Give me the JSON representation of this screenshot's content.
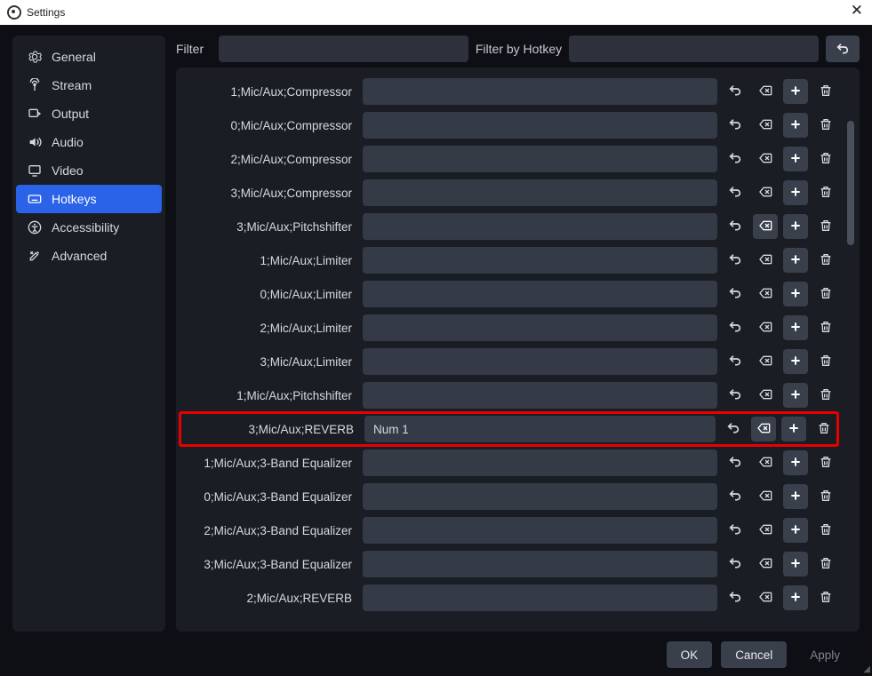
{
  "window": {
    "title": "Settings"
  },
  "sidebar": {
    "items": [
      {
        "label": "General",
        "icon": "gear-icon"
      },
      {
        "label": "Stream",
        "icon": "antenna-icon"
      },
      {
        "label": "Output",
        "icon": "output-icon"
      },
      {
        "label": "Audio",
        "icon": "speaker-icon"
      },
      {
        "label": "Video",
        "icon": "monitor-icon"
      },
      {
        "label": "Hotkeys",
        "icon": "keyboard-icon",
        "active": true
      },
      {
        "label": "Accessibility",
        "icon": "accessibility-icon"
      },
      {
        "label": "Advanced",
        "icon": "tools-icon"
      }
    ]
  },
  "filter": {
    "label": "Filter",
    "value": "",
    "hotkey_label": "Filter by Hotkey",
    "hotkey_value": ""
  },
  "hotkeys": [
    {
      "label": "1;Mic/Aux;Compressor",
      "value": ""
    },
    {
      "label": "0;Mic/Aux;Compressor",
      "value": ""
    },
    {
      "label": "2;Mic/Aux;Compressor",
      "value": ""
    },
    {
      "label": "3;Mic/Aux;Compressor",
      "value": ""
    },
    {
      "label": "3;Mic/Aux;Pitchshifter",
      "value": "",
      "clear_solid": true
    },
    {
      "label": "1;Mic/Aux;Limiter",
      "value": ""
    },
    {
      "label": "0;Mic/Aux;Limiter",
      "value": ""
    },
    {
      "label": "2;Mic/Aux;Limiter",
      "value": ""
    },
    {
      "label": "3;Mic/Aux;Limiter",
      "value": ""
    },
    {
      "label": "1;Mic/Aux;Pitchshifter",
      "value": ""
    },
    {
      "label": "3;Mic/Aux;REVERB",
      "value": "Num 1",
      "highlight": true,
      "clear_solid": true
    },
    {
      "label": "1;Mic/Aux;3-Band Equalizer",
      "value": ""
    },
    {
      "label": "0;Mic/Aux;3-Band Equalizer",
      "value": ""
    },
    {
      "label": "2;Mic/Aux;3-Band Equalizer",
      "value": ""
    },
    {
      "label": "3;Mic/Aux;3-Band Equalizer",
      "value": ""
    },
    {
      "label": "2;Mic/Aux;REVERB",
      "value": ""
    }
  ],
  "footer": {
    "ok": "OK",
    "cancel": "Cancel",
    "apply": "Apply"
  }
}
